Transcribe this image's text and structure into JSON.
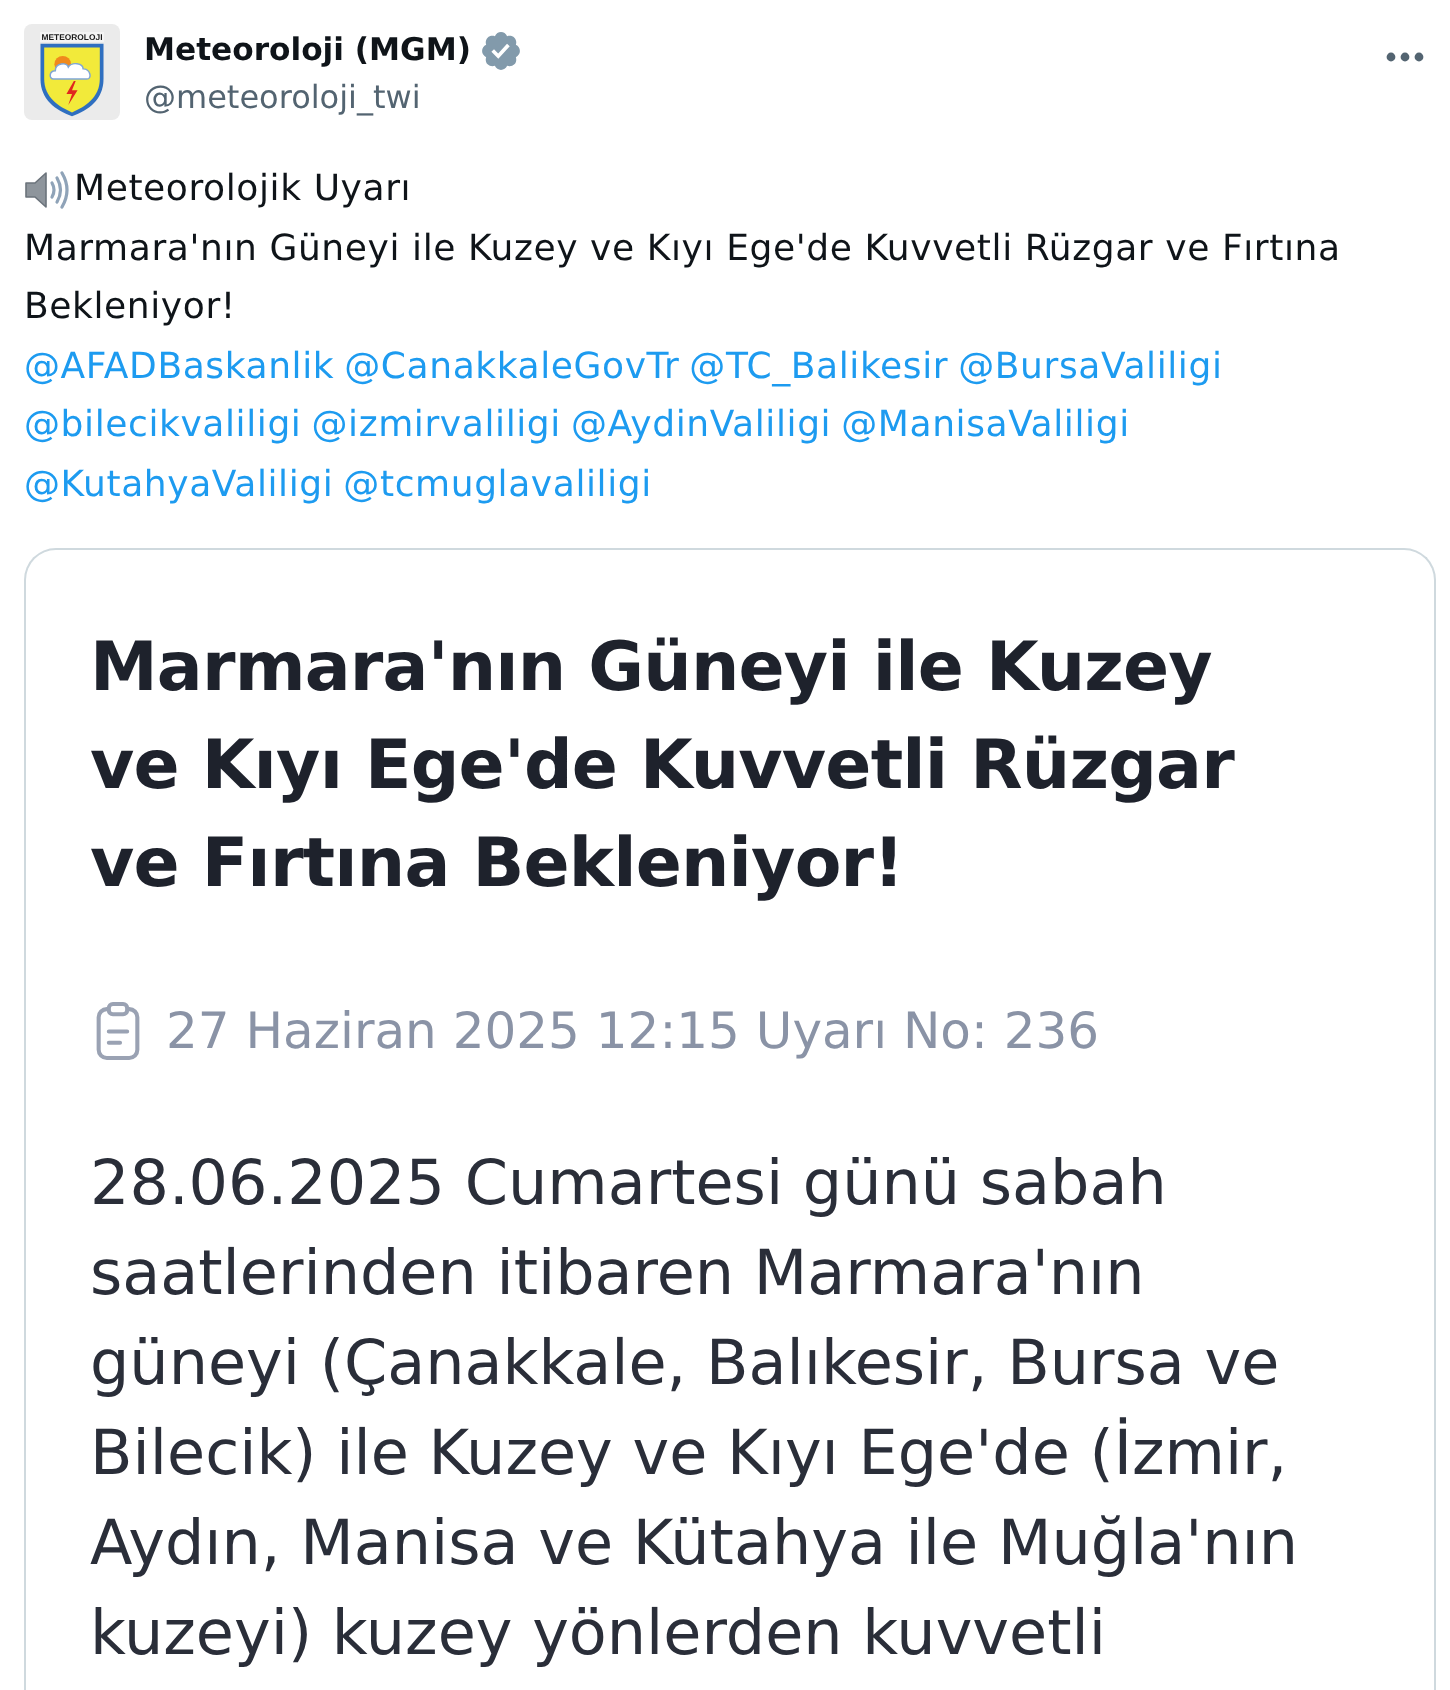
{
  "author": {
    "avatar": {
      "logo_text": "METEOROLOJI"
    },
    "name": "Meteoroloji (MGM)",
    "verified": true,
    "handle": "@meteoroloji_twi"
  },
  "tweet": {
    "title": "Meteorolojik Uyarı",
    "text": "Marmara'nın Güneyi ile Kuzey ve Kıyı Ege'de Kuvvetli Rüzgar ve Fırtına Bekleniyor!",
    "mentions": [
      "@AFADBaskanlik",
      "@CanakkaleGovTr",
      "@TC_Balikesir",
      "@BursaValiligi",
      "@bilecikvaliligi",
      "@izmirvaliligi",
      "@AydinValiligi",
      "@ManisaValiligi",
      "@KutahyaValiligi",
      "@tcmuglavaliligi"
    ]
  },
  "attached_image": {
    "headline": "Marmara'nın Güneyi ile Kuzey ve Kıyı Ege'de Kuvvetli Rüzgar ve Fırtına Bekleniyor!",
    "meta": "27 Haziran 2025 12:15 Uyarı No: 236",
    "body": "28.06.2025 Cumartesi günü sabah saatlerinden itibaren Marmara'nın güneyi (Çanakkale, Balıkesir, Bursa ve Bilecik) ile Kuzey ve Kıyı Ege'de (İzmir, Aydın, Manisa ve Kütahya ile Muğla'nın kuzeyi) kuzey yönlerden kuvvetli"
  }
}
